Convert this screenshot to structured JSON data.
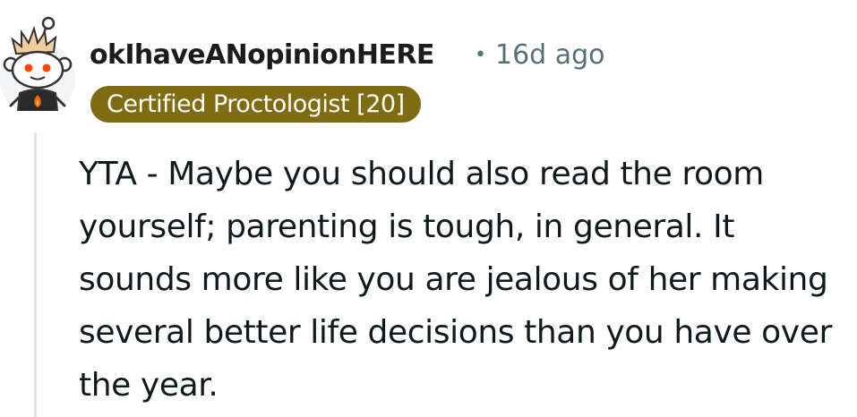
{
  "comment": {
    "author": "okIhaveANopinionHERE",
    "separator": "•",
    "age": "16d ago",
    "flair": "Certified Proctologist [20]",
    "body": "YTA - Maybe you should also read the room yourself; parenting is tough, in general. It sounds more like you are jealous of her making several better life decisions than you have over the year."
  },
  "avatar": {
    "icon": "snoo-avatar-icon"
  },
  "colors": {
    "flair_bg": "#7f6b12",
    "flair_text": "#ffffff",
    "username": "#1c1c1c",
    "meta": "#576f76",
    "body": "#0f1a1c",
    "thread_line": "#e3e6e8"
  }
}
